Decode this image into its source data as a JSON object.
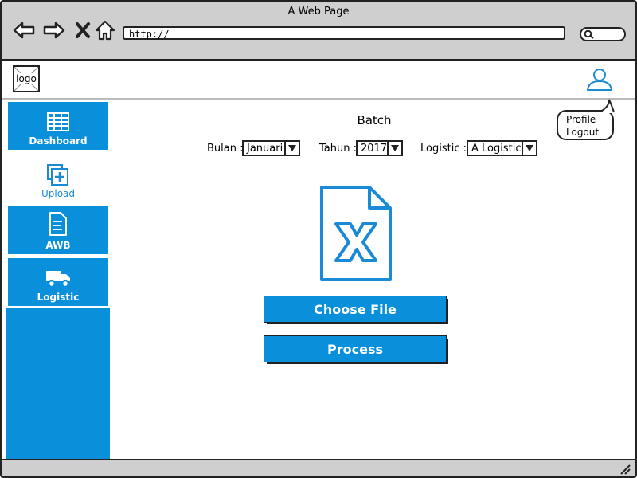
{
  "window": {
    "title": "A Web Page"
  },
  "browser": {
    "url": "http://"
  },
  "header": {
    "logo_label": "logo"
  },
  "profile_menu": {
    "items": [
      "Profile",
      "Logout"
    ]
  },
  "sidebar": {
    "items": [
      {
        "label": "Dashboard",
        "icon": "table-icon"
      },
      {
        "label": "Upload",
        "icon": "upload-icon",
        "active": true
      },
      {
        "label": "AWB",
        "icon": "document-icon"
      },
      {
        "label": "Logistic",
        "icon": "truck-icon"
      }
    ]
  },
  "main": {
    "title": "Batch",
    "filters": {
      "bulan": {
        "label": "Bulan :",
        "value": "Januari"
      },
      "tahun": {
        "label": "Tahun :",
        "value": "2017"
      },
      "logistic": {
        "label": "Logistic :",
        "value": "A Logistic"
      }
    },
    "file_icon": "excel-file-icon",
    "choose_file_label": "Choose File",
    "process_label": "Process"
  },
  "colors": {
    "accent": "#0a90db",
    "chrome": "#cfcfcf"
  }
}
